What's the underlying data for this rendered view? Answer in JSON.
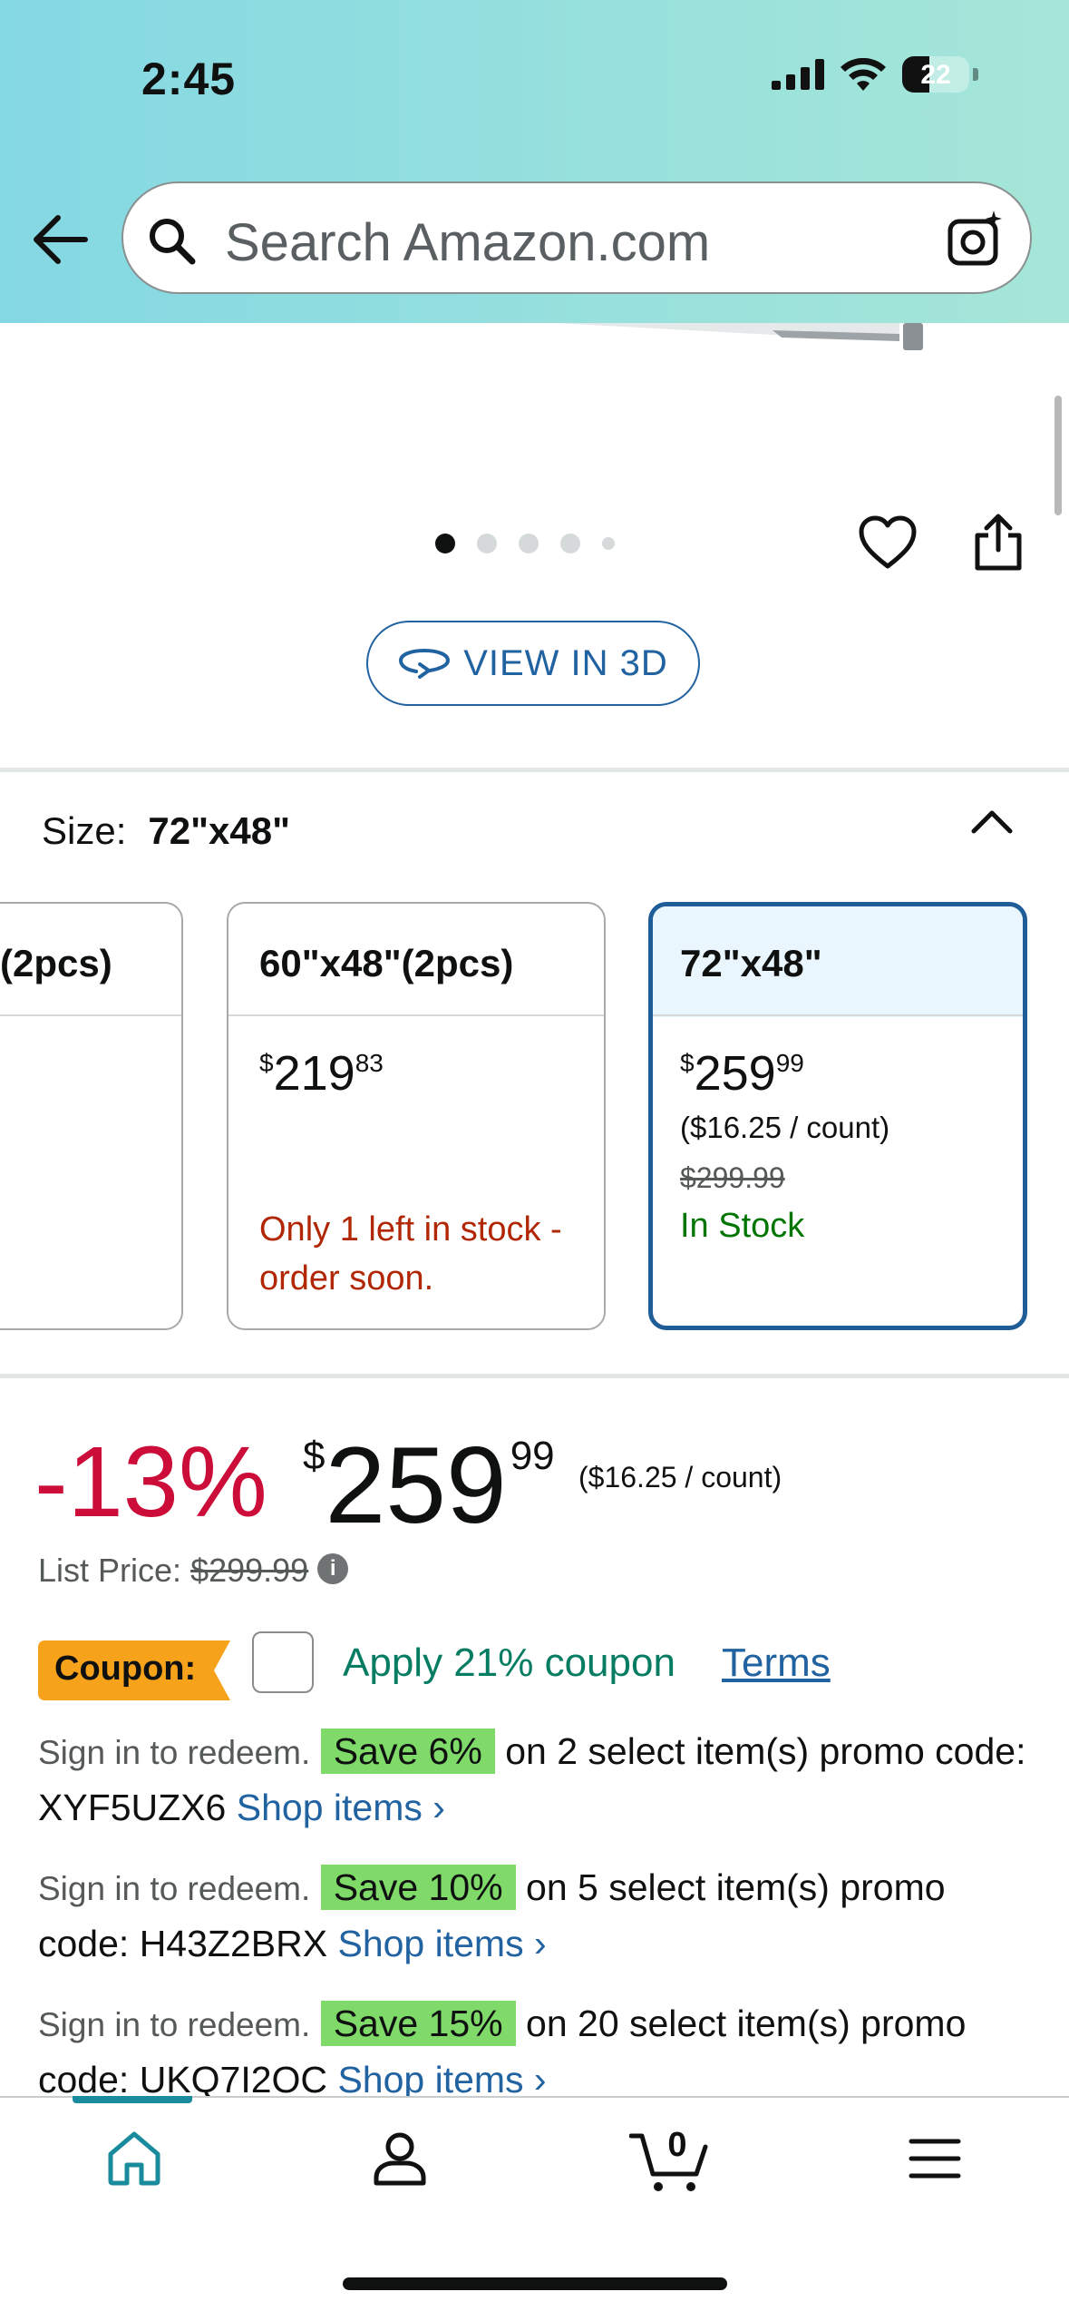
{
  "status_bar": {
    "time": "2:45",
    "battery": "22"
  },
  "search": {
    "placeholder": "Search Amazon.com"
  },
  "gallery": {
    "view_3d_label": "VIEW IN 3D"
  },
  "size": {
    "label": "Size:",
    "selected": "72\"x48\"",
    "options": [
      {
        "title": "(2pcs)"
      },
      {
        "title": "60\"x48\"(2pcs)",
        "price_symbol": "$",
        "price_whole": "219",
        "price_cents": "83",
        "stock": "Only 1 left in stock - order soon."
      },
      {
        "title": "72\"x48\"",
        "price_symbol": "$",
        "price_whole": "259",
        "price_cents": "99",
        "per_count": "($16.25 / count)",
        "list_price": "$299.99",
        "stock": "In Stock"
      }
    ]
  },
  "price": {
    "discount": "-13%",
    "symbol": "$",
    "whole": "259",
    "cents": "99",
    "per_count": "($16.25 / count)",
    "list_price_label": "List Price:",
    "list_price": "$299.99"
  },
  "coupon": {
    "tag": "Coupon:",
    "apply_text": "Apply 21% coupon",
    "terms": "Terms"
  },
  "promos": [
    {
      "signin": "Sign in to redeem.",
      "save": "Save 6%",
      "text": "on 2 select item(s) promo code: XYF5UZX6",
      "link": "Shop items ›"
    },
    {
      "signin": "Sign in to redeem.",
      "save": "Save 10%",
      "text": "on 5 select item(s) promo code: H43Z2BRX",
      "link": "Shop items ›"
    },
    {
      "signin": "Sign in to redeem.",
      "save": "Save 15%",
      "text": "on 20 select item(s) promo code: UKQ7I2OC",
      "link": "Shop items ›"
    }
  ],
  "bottom_nav": {
    "cart_count": "0",
    "items": [
      "home-icon",
      "account-icon",
      "cart-icon",
      "menu-icon"
    ]
  },
  "colors": {
    "accent_teal": "#1a8b9d",
    "link_blue": "#2162a1",
    "discount_red": "#cc0c39",
    "save_green": "#7fda69",
    "coupon_orange": "#f7a21b"
  }
}
